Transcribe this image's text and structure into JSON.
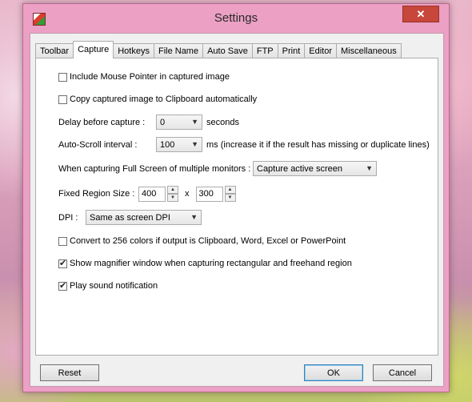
{
  "window": {
    "title": "Settings",
    "close_label": "✕"
  },
  "tabs": [
    {
      "label": "Toolbar"
    },
    {
      "label": "Capture"
    },
    {
      "label": "Hotkeys"
    },
    {
      "label": "File Name"
    },
    {
      "label": "Auto Save"
    },
    {
      "label": "FTP"
    },
    {
      "label": "Print"
    },
    {
      "label": "Editor"
    },
    {
      "label": "Miscellaneous"
    }
  ],
  "active_tab": "Capture",
  "capture": {
    "include_mouse_pointer": {
      "label": "Include Mouse Pointer in captured image",
      "checked": false
    },
    "copy_to_clipboard": {
      "label": "Copy captured image to Clipboard automatically",
      "checked": false
    },
    "delay": {
      "label": "Delay before capture :",
      "value": "0",
      "unit": "seconds"
    },
    "autoscroll": {
      "label": "Auto-Scroll interval :",
      "value": "100",
      "note": "ms (increase it if the result has missing or duplicate lines)"
    },
    "multi_monitor": {
      "label": "When capturing Full Screen of multiple monitors :",
      "value": "Capture active screen"
    },
    "fixed_region": {
      "label": "Fixed Region Size :",
      "width": "400",
      "separator": "x",
      "height": "300"
    },
    "dpi": {
      "label": "DPI :",
      "value": "Same as screen DPI"
    },
    "convert_256": {
      "label": "Convert to 256 colors if output is Clipboard, Word, Excel or PowerPoint",
      "checked": false
    },
    "magnifier": {
      "label": "Show magnifier window when capturing rectangular and freehand region",
      "checked": true
    },
    "sound": {
      "label": "Play sound notification",
      "checked": true
    }
  },
  "buttons": {
    "reset": "Reset",
    "ok": "OK",
    "cancel": "Cancel"
  }
}
